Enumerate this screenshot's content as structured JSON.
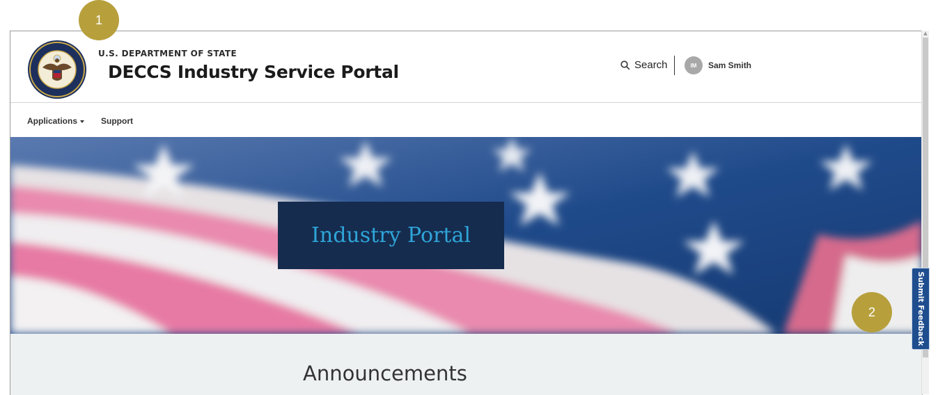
{
  "header": {
    "department": "U.S. DEPARTMENT OF STATE",
    "portal_title": "DECCS Industry Service Portal",
    "search_label": "Search",
    "user_initials": "IM",
    "user_name": "Sam Smith"
  },
  "nav": {
    "items": [
      {
        "label": "Applications",
        "has_dropdown": true
      },
      {
        "label": "Support",
        "has_dropdown": false
      }
    ]
  },
  "hero": {
    "title": "Industry Portal"
  },
  "announcements": {
    "title": "Announcements"
  },
  "feedback": {
    "label": "Submit Feedback"
  },
  "markers": [
    {
      "label": "1"
    },
    {
      "label": "2"
    }
  ],
  "colors": {
    "hero_box": "#152c4f",
    "hero_title": "#2fa5d8",
    "marker": "#b7a03c",
    "feedback": "#1f4e8f"
  }
}
